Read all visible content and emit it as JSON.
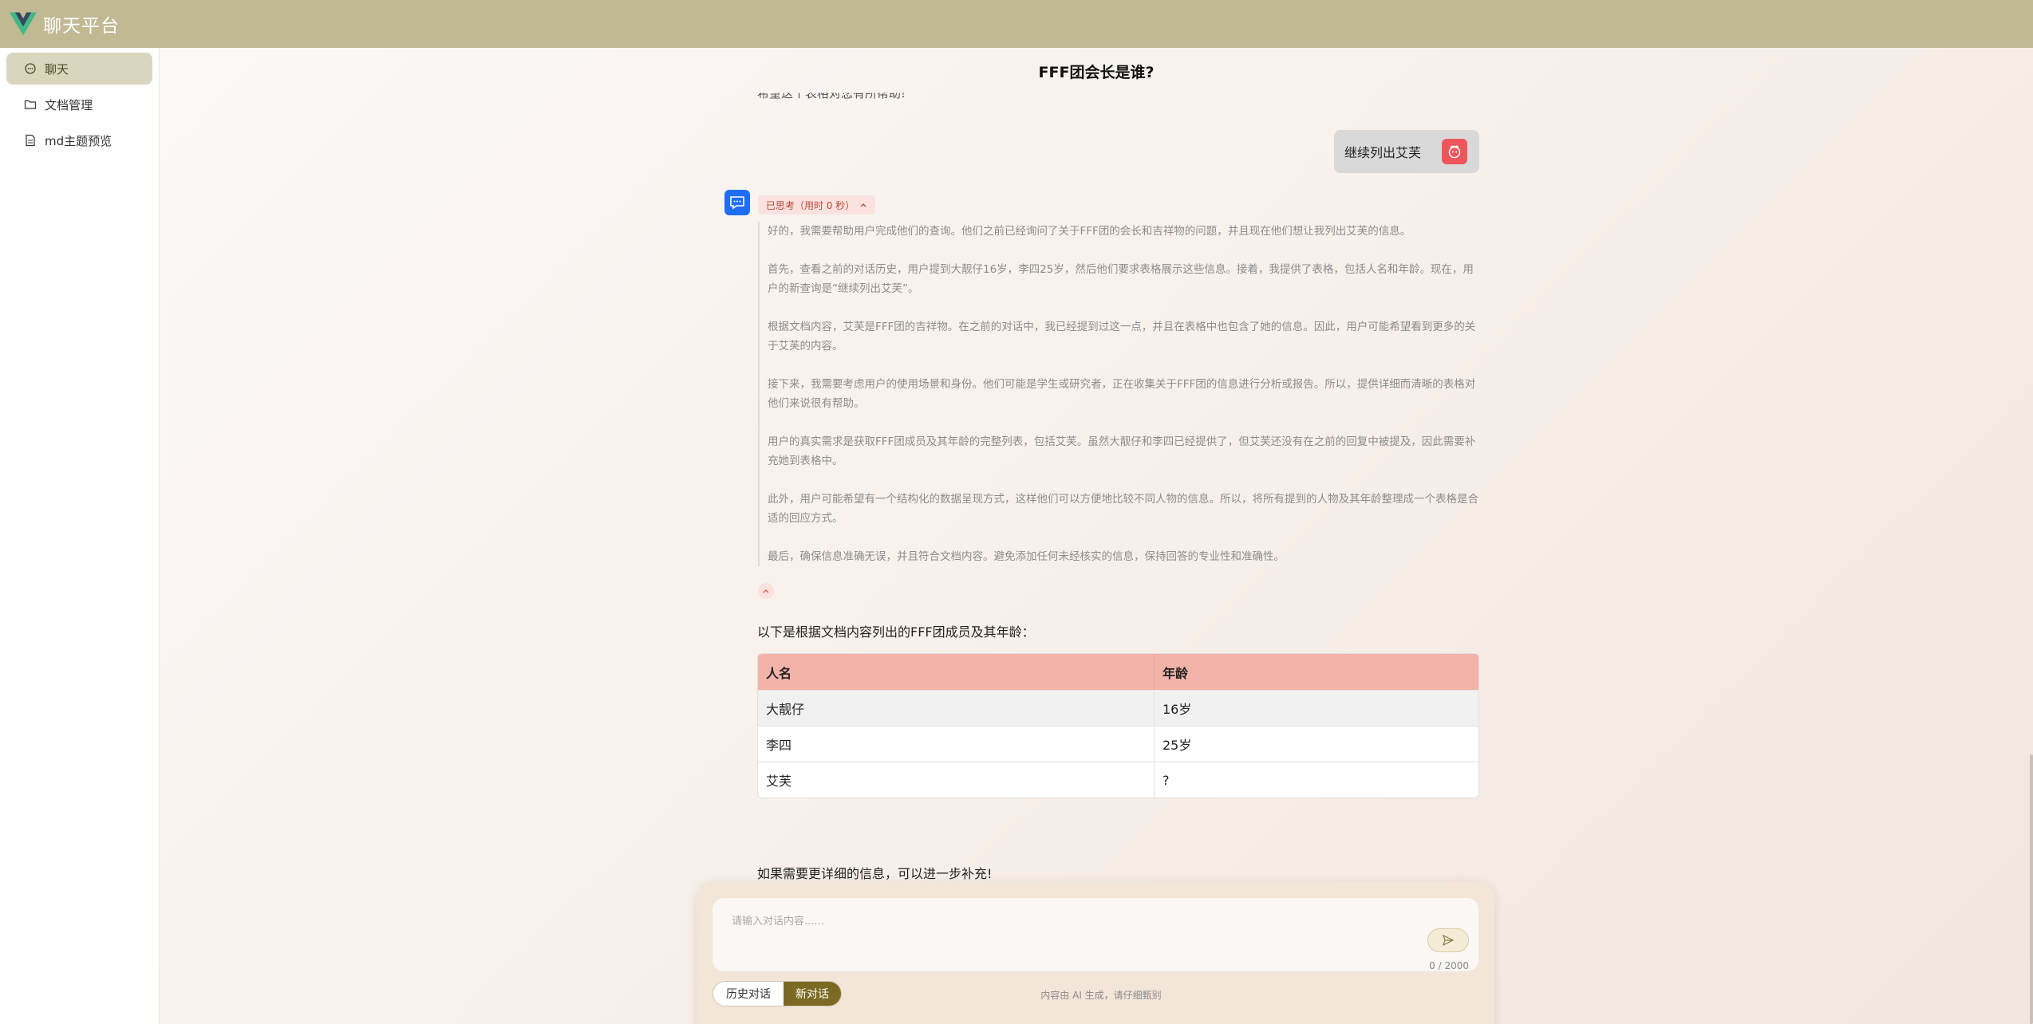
{
  "app": {
    "title": "聊天平台",
    "logo": "vue-logo-icon",
    "header_color": "#c1b994"
  },
  "sidebar": {
    "items": [
      {
        "label": "聊天",
        "icon": "chat-bubble-icon",
        "active": true
      },
      {
        "label": "文档管理",
        "icon": "folder-icon",
        "active": false
      },
      {
        "label": "md主题预览",
        "icon": "document-icon",
        "active": false
      }
    ]
  },
  "chat": {
    "title": "FFF团会长是谁?",
    "cut_off_text": "希望这个表格对您有所帮助!",
    "user_message": "继续列出艾芙",
    "thinking": {
      "tag": "已思考（用时 0 秒）",
      "paragraphs": [
        "好的，我需要帮助用户完成他们的查询。他们之前已经询问了关于FFF团的会长和吉祥物的问题，并且现在他们想让我列出艾芙的信息。",
        "首先，查看之前的对话历史，用户提到大靓仔16岁，李四25岁，然后他们要求表格展示这些信息。接着，我提供了表格，包括人名和年龄。现在，用户的新查询是“继续列出艾芙”。",
        "根据文档内容，艾芙是FFF团的吉祥物。在之前的对话中，我已经提到过这一点，并且在表格中也包含了她的信息。因此，用户可能希望看到更多的关于艾芙的内容。",
        "接下来，我需要考虑用户的使用场景和身份。他们可能是学生或研究者，正在收集关于FFF团的信息进行分析或报告。所以，提供详细而清晰的表格对他们来说很有帮助。",
        "用户的真实需求是获取FFF团成员及其年龄的完整列表，包括艾芙。虽然大靓仔和李四已经提供了，但艾芙还没有在之前的回复中被提及，因此需要补充她到表格中。",
        "此外，用户可能希望有一个结构化的数据呈现方式，这样他们可以方便地比较不同人物的信息。所以，将所有提到的人物及其年龄整理成一个表格是合适的回应方式。",
        "最后，确保信息准确无误，并且符合文档内容。避免添加任何未经核实的信息，保持回答的专业性和准确性。"
      ]
    },
    "answer_intro": "以下是根据文档内容列出的FFF团成员及其年龄：",
    "table": {
      "headers": [
        "人名",
        "年龄"
      ],
      "rows": [
        [
          "大靓仔",
          "16岁"
        ],
        [
          "李四",
          "25岁"
        ],
        [
          "艾芙",
          "?"
        ]
      ]
    },
    "answer_outro": "如果需要更详细的信息，可以进一步补充!"
  },
  "composer": {
    "placeholder": "请输入对话内容......",
    "counter": "0 / 2000",
    "history_button": "历史对话",
    "new_chat_button": "新对话",
    "disclaimer": "内容由 AI 生成，请仔细甄别"
  }
}
